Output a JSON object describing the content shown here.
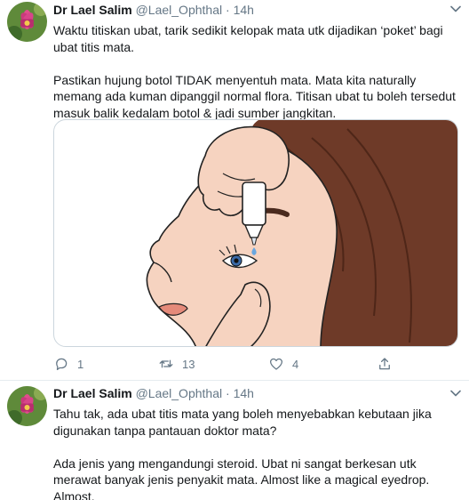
{
  "tweets": [
    {
      "author": {
        "name": "Dr Lael Salim",
        "handle": "@Lael_Ophthal",
        "separator": "·",
        "time": "14h"
      },
      "paragraphs": [
        [
          "Waktu titiskan ubat, tarik sedikit kelopak mata utk dijadikan ‘poket’ bagi",
          "ubat titis mata."
        ],
        [
          "Pastikan hujung botol TIDAK menyentuh mata. Mata kita naturally",
          "memang ada kuman dipanggil normal flora. Titisan ubat tu boleh tersedut",
          "masuk balik kedalam botol & jadi sumber jangkitan."
        ]
      ],
      "counts": {
        "replies": "1",
        "retweets": "13",
        "likes": "4"
      }
    },
    {
      "author": {
        "name": "Dr Lael Salim",
        "handle": "@Lael_Ophthal",
        "separator": "·",
        "time": "14h"
      },
      "paragraphs": [
        [
          "Tahu tak, ada ubat titis mata yang boleh menyebabkan kebutaan jika",
          "digunakan tanpa pantauan doktor mata?"
        ],
        [
          "Ada jenis yang mengandungi steroid. Ubat ni sangat berkesan utk",
          "merawat banyak jenis penyakit mata. Almost like a magical eyedrop.",
          "Almost."
        ]
      ]
    }
  ],
  "icons": {
    "avatar": "lotus-flower-avatar",
    "caret": "chevron-down-icon",
    "reply": "reply-icon",
    "retweet": "retweet-icon",
    "like": "heart-icon",
    "share": "share-icon"
  },
  "colors": {
    "text": "#14171a",
    "secondary": "#657786",
    "border": "#e6ecf0",
    "skin": "#f6d3c0",
    "hair": "#6e3a28"
  }
}
